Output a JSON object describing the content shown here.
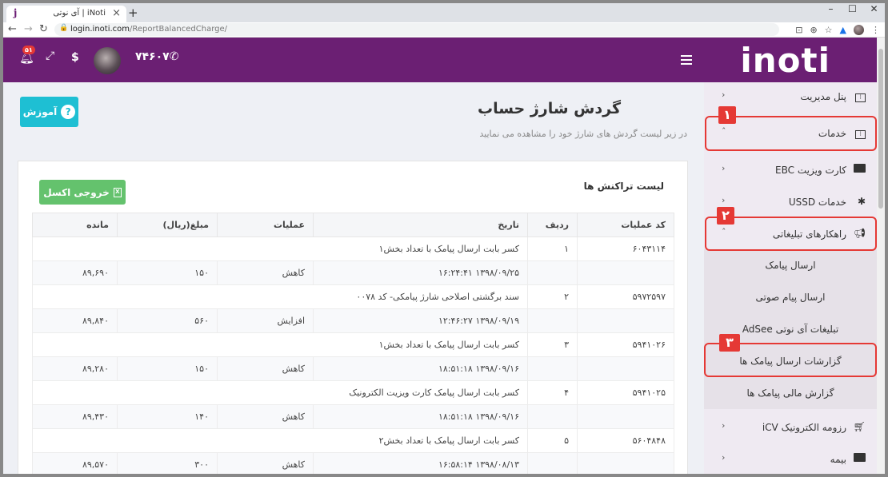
{
  "browser": {
    "tab_title": "iNoti | آی نوتی",
    "tab_favicon": "j",
    "url_host": "login.inoti.com",
    "url_path": "/ReportBalancedCharge/"
  },
  "header": {
    "logo": "inoti",
    "phone": "۷۴۶۰۷",
    "notification_count": "۵۱",
    "brand_color": "#6b1f73"
  },
  "page": {
    "help_label": "آموزش",
    "title": "گردش شارژ حساب",
    "subtitle": "در زیر لیست گردش های شارژ خود را مشاهده می نمایید"
  },
  "card": {
    "title": "لیست تراکنش ها",
    "excel_label": "خروجی اکسل"
  },
  "table": {
    "headers": [
      "کد عملیات",
      "ردیف",
      "تاریخ",
      "عملیات",
      "مبلغ(ریال)",
      "مانده"
    ],
    "rows": [
      {
        "code": "۶۰۴۳۱۱۴",
        "row": "۱",
        "desc": "کسر بابت ارسال پیامک با تعداد بخش۱",
        "date": "۱۳۹۸/۰۹/۲۵ ۱۶:۲۴:۴۱",
        "op": "کاهش",
        "amount": "۱۵۰",
        "balance": "۸۹,۶۹۰"
      },
      {
        "code": "۵۹۷۲۵۹۷",
        "row": "۲",
        "desc": "سند برگشتی اصلاحی شارژ پیامکی- کد ۰۰۷۸",
        "date": "۱۳۹۸/۰۹/۱۹ ۱۲:۴۶:۲۷",
        "op": "افزایش",
        "amount": "۵۶۰",
        "balance": "۸۹,۸۴۰"
      },
      {
        "code": "۵۹۴۱۰۲۶",
        "row": "۳",
        "desc": "کسر بابت ارسال پیامک با تعداد بخش۱",
        "date": "۱۳۹۸/۰۹/۱۶ ۱۸:۵۱:۱۸",
        "op": "کاهش",
        "amount": "۱۵۰",
        "balance": "۸۹,۲۸۰"
      },
      {
        "code": "۵۹۴۱۰۲۵",
        "row": "۴",
        "desc": "کسر بابت ارسال پیامک کارت ویزیت الکترونیک",
        "date": "۱۳۹۸/۰۹/۱۶ ۱۸:۵۱:۱۸",
        "op": "کاهش",
        "amount": "۱۴۰",
        "balance": "۸۹,۴۳۰"
      },
      {
        "code": "۵۶۰۴۸۴۸",
        "row": "۵",
        "desc": "کسر بابت ارسال پیامک با تعداد بخش۲",
        "date": "۱۳۹۸/۰۸/۱۳ ۱۶:۵۸:۱۴",
        "op": "کاهش",
        "amount": "۳۰۰",
        "balance": "۸۹,۵۷۰"
      }
    ]
  },
  "sidebar": {
    "items": [
      {
        "label": "پنل مدیریت",
        "icon": "sliders-icon"
      },
      {
        "label": "خدمات",
        "icon": "sliders-icon"
      },
      {
        "label": "کارت ویزیت EBC",
        "icon": "id-card-icon"
      },
      {
        "label": "خدمات USSD",
        "icon": "gear-icon"
      },
      {
        "label": "راهکارهای تبلیغاتی",
        "icon": "megaphone-icon"
      },
      {
        "label": "رزومه الکترونیک iCV",
        "icon": "cart-icon"
      },
      {
        "label": "بیمه",
        "icon": "id-card-icon"
      }
    ],
    "sub_items": [
      {
        "label": "ارسال پیامک"
      },
      {
        "label": "ارسال پیام صوتی"
      },
      {
        "label": "تبلیغات آی نوتی AdSee"
      },
      {
        "label": "گزارشات ارسال پیامک ها"
      },
      {
        "label": "گزارش مالی پیامک ها"
      }
    ]
  },
  "annotations": [
    "۱",
    "۲",
    "۳"
  ]
}
